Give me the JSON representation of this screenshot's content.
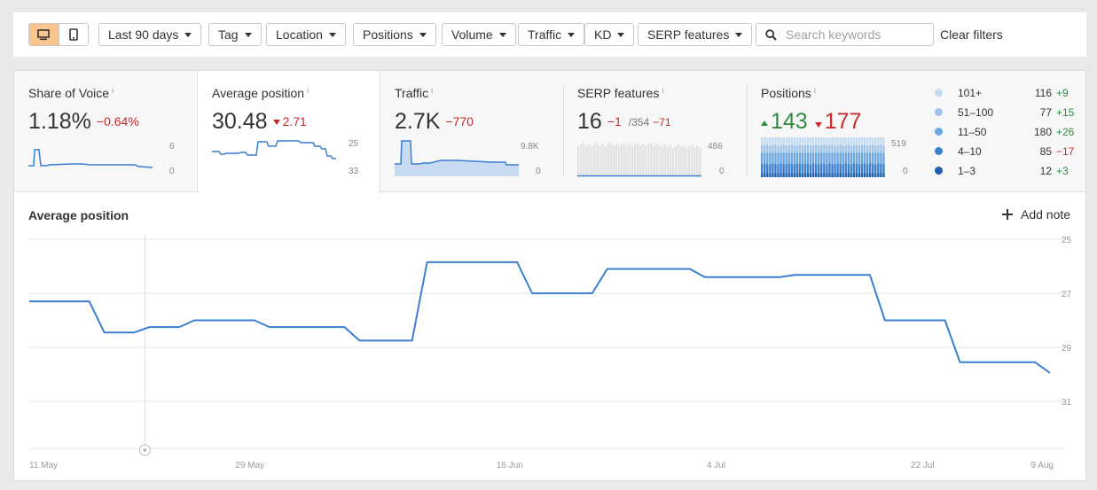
{
  "filters": {
    "date_range": "Last 90 days",
    "tag": "Tag",
    "location": "Location",
    "positions": "Positions",
    "volume": "Volume",
    "traffic": "Traffic",
    "kd": "KD",
    "serp_features": "SERP features",
    "search_placeholder": "Search keywords",
    "clear": "Clear filters",
    "device_selected": "desktop"
  },
  "metrics": {
    "sov": {
      "title": "Share of Voice",
      "info": "i",
      "value": "1.18%",
      "delta": "−0.64%",
      "max": "6",
      "min": "0"
    },
    "avgpos": {
      "title": "Average position",
      "info": "i",
      "value": "30.48",
      "delta": "2.71",
      "top": "25",
      "bottom": "33"
    },
    "traffic": {
      "title": "Traffic",
      "info": "i",
      "value": "2.7K",
      "delta": "−770",
      "max": "9.8K",
      "min": "0"
    },
    "serp": {
      "title": "SERP features",
      "info": "i",
      "value": "16",
      "delta": "−1",
      "total": "/354",
      "total_delta": "−71",
      "max": "486",
      "min": "0"
    },
    "positions": {
      "title": "Positions",
      "info": "i",
      "up": "143",
      "down": "177",
      "max": "519",
      "min": "0"
    }
  },
  "legend": [
    {
      "label": "101+",
      "count": "116",
      "change": "+9",
      "color": "#c6dcf3"
    },
    {
      "label": "51–100",
      "count": "77",
      "change": "+15",
      "color": "#9fc4ea"
    },
    {
      "label": "11–50",
      "count": "180",
      "change": "+26",
      "color": "#6ba6e0"
    },
    {
      "label": "4–10",
      "count": "85",
      "change": "−17",
      "color": "#3b7fd0"
    },
    {
      "label": "1–3",
      "count": "12",
      "change": "+3",
      "color": "#1f5fad"
    }
  ],
  "chart": {
    "title": "Average position",
    "add_note": "Add note",
    "colors": {
      "line": "#3b7fd0",
      "grid": "#e6e6e6"
    }
  },
  "chart_data": {
    "type": "line",
    "title": "Average position",
    "y_inverted": true,
    "ylim": [
      25,
      32
    ],
    "y_ticks": [
      "25",
      "27",
      "29",
      "31"
    ],
    "x_labels": [
      "11 May",
      "29 May",
      "16 Jun",
      "4 Jul",
      "22 Jul",
      "9 Aug"
    ],
    "grid": true,
    "series": [
      {
        "values": [
          [
            0,
            27.3
          ],
          [
            4,
            27.3
          ],
          [
            5,
            28.45
          ],
          [
            7,
            28.45
          ],
          [
            8,
            28.25
          ],
          [
            10,
            28.25
          ],
          [
            11,
            28.0
          ],
          [
            15,
            28.0
          ],
          [
            16,
            28.25
          ],
          [
            21,
            28.25
          ],
          [
            22,
            28.75
          ],
          [
            25.5,
            28.75
          ],
          [
            26.5,
            25.85
          ],
          [
            32.5,
            25.85
          ],
          [
            33.5,
            27.0
          ],
          [
            37.5,
            27.0
          ],
          [
            38.5,
            26.1
          ],
          [
            44,
            26.1
          ],
          [
            45,
            26.4
          ],
          [
            50,
            26.4
          ],
          [
            51,
            26.32
          ],
          [
            56,
            26.32
          ],
          [
            57,
            28.0
          ],
          [
            61,
            28.0
          ],
          [
            62,
            29.55
          ],
          [
            67,
            29.55
          ],
          [
            68,
            29.95
          ]
        ]
      }
    ]
  }
}
